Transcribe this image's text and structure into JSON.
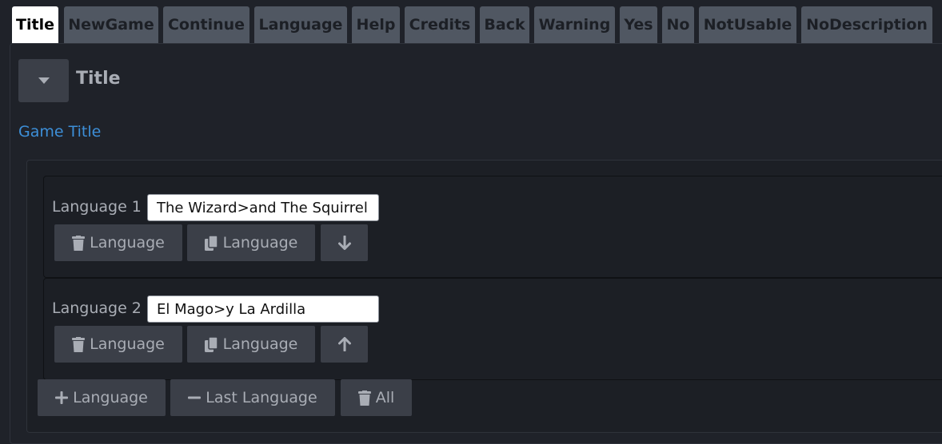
{
  "tabs": [
    {
      "label": "Title",
      "active": true
    },
    {
      "label": "NewGame"
    },
    {
      "label": "Continue"
    },
    {
      "label": "Language"
    },
    {
      "label": "Help"
    },
    {
      "label": "Credits"
    },
    {
      "label": "Back"
    },
    {
      "label": "Warning"
    },
    {
      "label": "Yes"
    },
    {
      "label": "No"
    },
    {
      "label": "NotUsable"
    },
    {
      "label": "NoDescription"
    }
  ],
  "panel": {
    "title": "Title",
    "section_label": "Game Title"
  },
  "entries": [
    {
      "label": "Language 1",
      "value": "The Wizard>and The Squirrel",
      "delete_label": "Language",
      "copy_label": "Language",
      "move_icon": "arrow-down-icon"
    },
    {
      "label": "Language 2",
      "value": "El Mago>y La Ardilla",
      "delete_label": "Language",
      "copy_label": "Language",
      "move_icon": "arrow-up-icon"
    }
  ],
  "footer": {
    "add_label": "Language",
    "remove_last_label": "Last Language",
    "delete_all_label": "All"
  },
  "colors": {
    "background": "#1f2229",
    "tab": "#505762",
    "tab_active": "#ffffff",
    "button": "#3b3f48",
    "accent_link": "#3d8fd8"
  }
}
